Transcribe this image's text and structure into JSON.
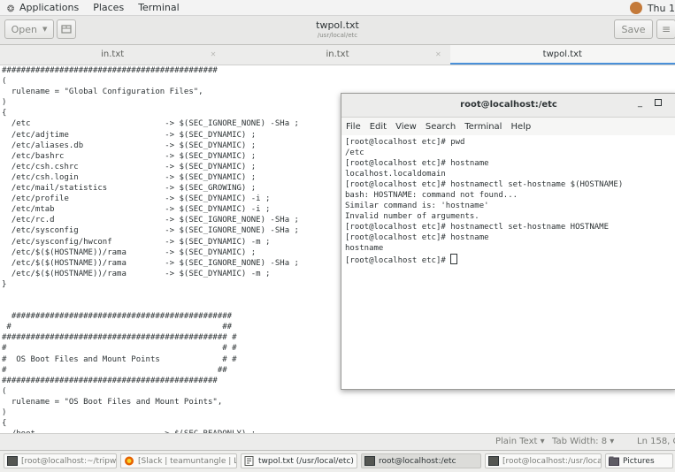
{
  "top_panel": {
    "applications": "Applications",
    "places": "Places",
    "terminal": "Terminal",
    "clock": "Thu 1"
  },
  "header": {
    "open_label": "Open",
    "save_label": "Save",
    "title": "twpol.txt",
    "subtitle": "/usr/local/etc"
  },
  "tabs": [
    {
      "label": "in.txt"
    },
    {
      "label": "in.txt"
    },
    {
      "label": "twpol.txt"
    }
  ],
  "editor": {
    "text": "#############################################\n(\n  rulename = \"Global Configuration Files\",\n)\n{\n  /etc                            -> $(SEC_IGNORE_NONE) -SHa ;\n  /etc/adjtime                    -> $(SEC_DYNAMIC) ;\n  /etc/aliases.db                 -> $(SEC_DYNAMIC) ;\n  /etc/bashrc                     -> $(SEC_DYNAMIC) ;\n  /etc/csh.cshrc                  -> $(SEC_DYNAMIC) ;\n  /etc/csh.login                  -> $(SEC_DYNAMIC) ;\n  /etc/mail/statistics            -> $(SEC_GROWING) ;\n  /etc/profile                    -> $(SEC_DYNAMIC) -i ;\n  /etc/mtab                       -> $(SEC_DYNAMIC) -i ;\n  /etc/rc.d                       -> $(SEC_IGNORE_NONE) -SHa ;\n  /etc/sysconfig                  -> $(SEC_IGNORE_NONE) -SHa ;\n  /etc/sysconfig/hwconf           -> $(SEC_DYNAMIC) -m ;\n  /etc/$($(HOSTNAME))/rama        -> $(SEC_DYNAMIC) ;\n  /etc/$($(HOSTNAME))/rama        -> $(SEC_IGNORE_NONE) -SHa ;\n  /etc/$($(HOSTNAME))/rama        -> $(SEC_DYNAMIC) -m ;\n}\n\n\n  ##############################################\n #                                            ##\n############################################### #\n#                                             # #\n#  OS Boot Files and Mount Points             # #\n#                                            ##\n#############################################\n(\n  rulename = \"OS Boot Files and Mount Points\",\n)\n{\n  /boot                          -> $(SEC_READONLY) ;"
  },
  "terminal": {
    "title": "root@localhost:/etc",
    "menu": [
      "File",
      "Edit",
      "View",
      "Search",
      "Terminal",
      "Help"
    ],
    "output": "[root@localhost etc]# pwd\n/etc\n[root@localhost etc]# hostname\nlocalhost.localdomain\n[root@localhost etc]# hostnamectl set-hostname $(HOSTNAME)\nbash: HOSTNAME: command not found...\nSimilar command is: 'hostname'\nInvalid number of arguments.\n[root@localhost etc]# hostnamectl set-hostname HOSTNAME\n[root@localhost etc]# hostname\nhostname\n[root@localhost etc]# "
  },
  "status": {
    "language": "Plain Text ▾",
    "tab_width": "Tab Width: 8 ▾",
    "position": "Ln 158, Co"
  },
  "taskbar": [
    {
      "label": "[root@localhost:~/tripwir…",
      "icon": "terminal-icon"
    },
    {
      "label": "[Slack | teamuntangle | L…",
      "icon": "browser-icon"
    },
    {
      "label": "twpol.txt (/usr/local/etc) …",
      "icon": "text-editor-icon"
    },
    {
      "label": "root@localhost:/etc",
      "icon": "terminal-icon"
    },
    {
      "label": "[root@localhost:/usr/loca…",
      "icon": "terminal-icon"
    },
    {
      "label": "Pictures",
      "icon": "folder-icon"
    }
  ]
}
